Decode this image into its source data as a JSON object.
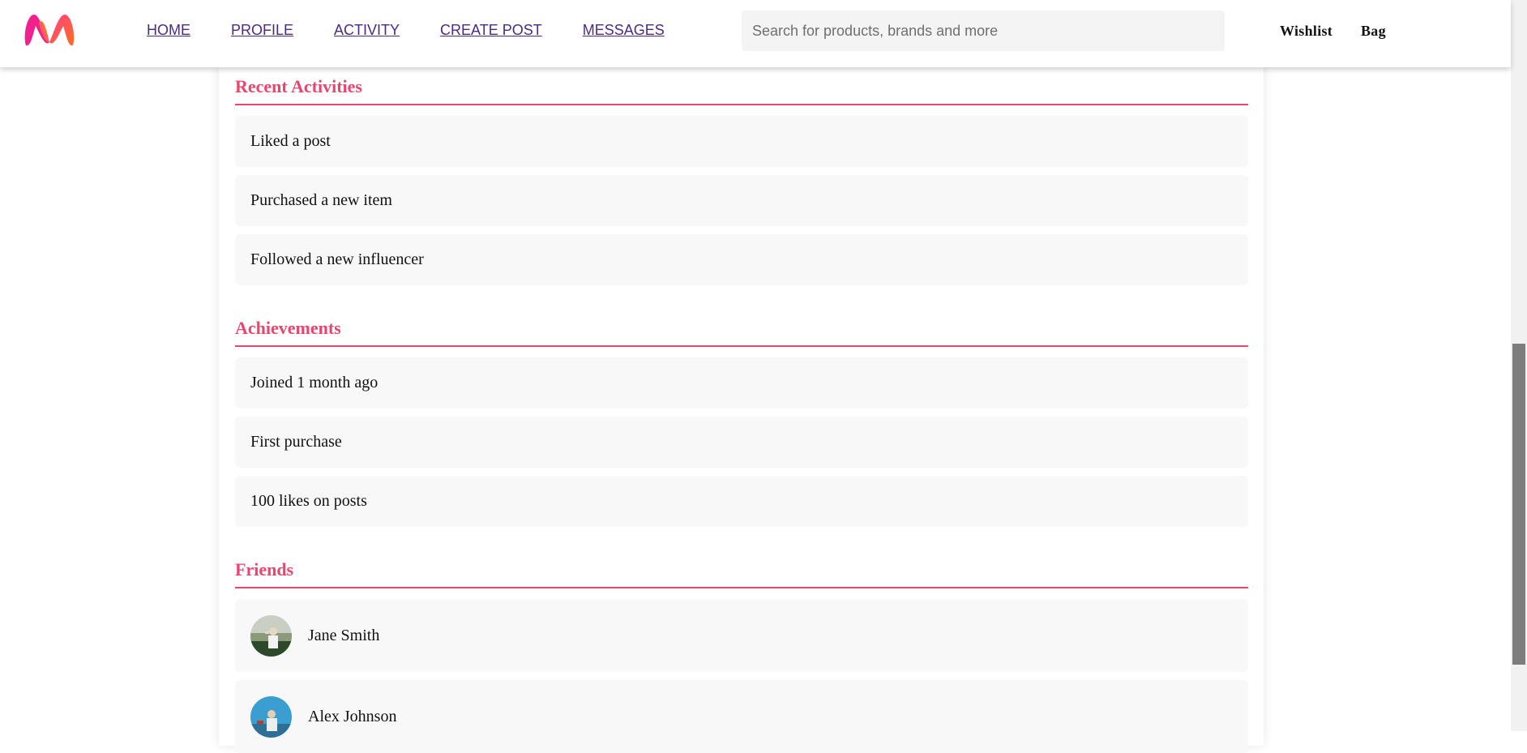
{
  "header": {
    "nav": [
      {
        "label": "HOME"
      },
      {
        "label": "PROFILE"
      },
      {
        "label": "ACTIVITY"
      },
      {
        "label": "CREATE POST"
      },
      {
        "label": "MESSAGES"
      }
    ],
    "search_placeholder": "Search for products, brands and more",
    "wishlist": "Wishlist",
    "bag": "Bag",
    "accent": "#e8466e",
    "nav_color": "#4b2a82"
  },
  "sections": {
    "recent": {
      "title": "Recent Activities",
      "items": [
        "Liked a post",
        "Purchased a new item",
        "Followed a new influencer"
      ]
    },
    "achievements": {
      "title": "Achievements",
      "items": [
        "Joined 1 month ago",
        "First purchase",
        "100 likes on posts"
      ]
    },
    "friends": {
      "title": "Friends",
      "items": [
        {
          "name": "Jane Smith",
          "avatar": "avatar-photo"
        },
        {
          "name": "Alex Johnson",
          "avatar": "avatar-photo"
        }
      ]
    }
  }
}
